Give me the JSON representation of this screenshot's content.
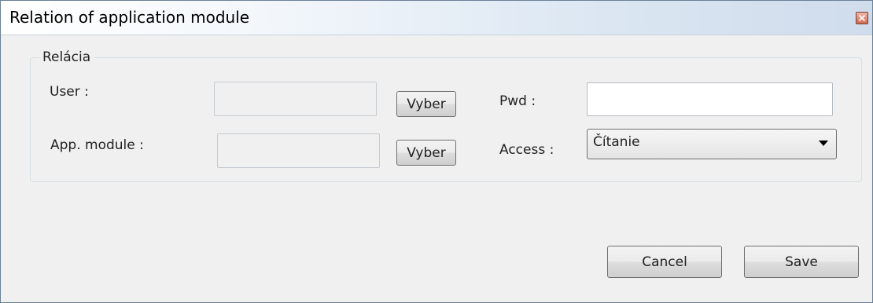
{
  "window": {
    "title": "Relation of application module",
    "close_icon": "close-icon"
  },
  "group": {
    "legend": "Relácia"
  },
  "user": {
    "label": "User :",
    "value": "",
    "button_label": "Vyber"
  },
  "app_module": {
    "label": "App. module :",
    "value": "",
    "button_label": "Vyber"
  },
  "pwd": {
    "label": "Pwd :",
    "value": ""
  },
  "access": {
    "label": "Access :",
    "selected": "Čítanie",
    "arrow_icon": "dropdown-arrow-icon"
  },
  "footer": {
    "cancel_label": "Cancel",
    "save_label": "Save"
  }
}
